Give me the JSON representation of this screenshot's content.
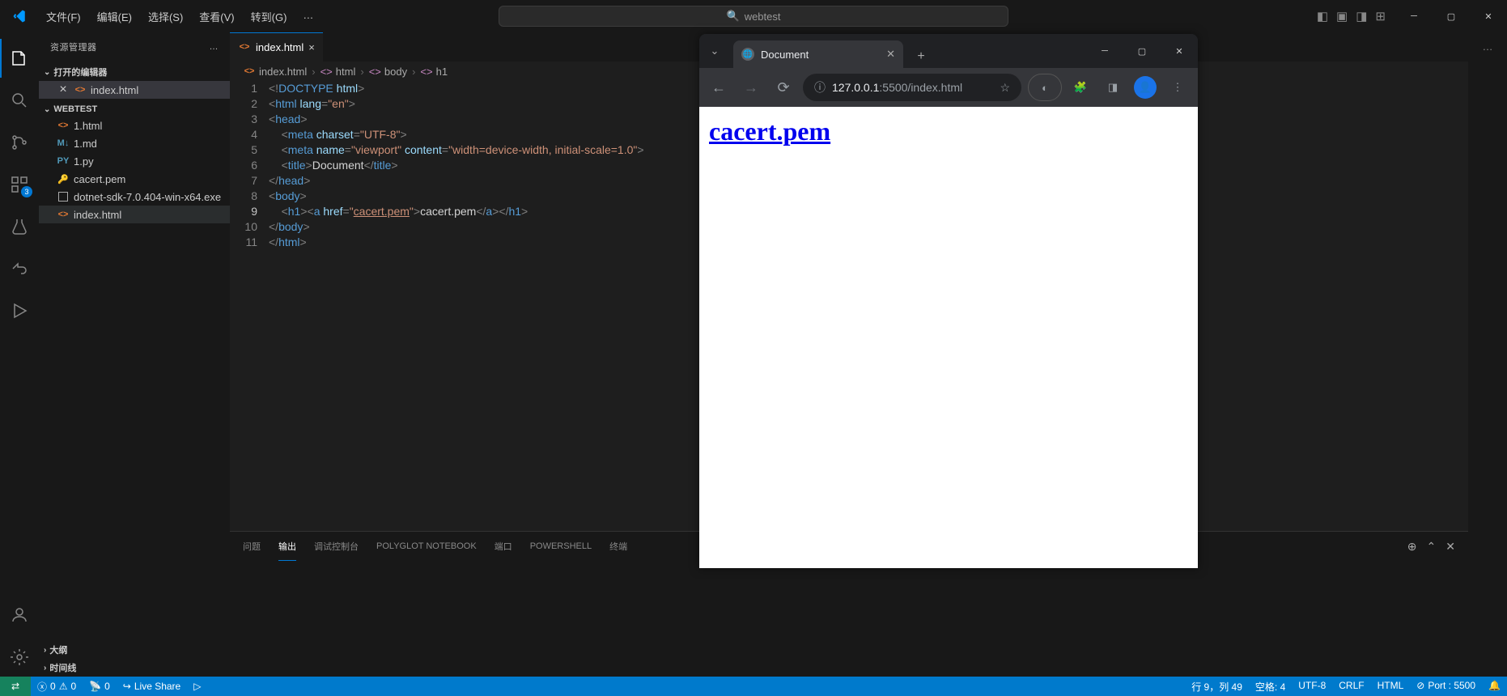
{
  "menu": {
    "file": "文件(F)",
    "edit": "编辑(E)",
    "select": "选择(S)",
    "view": "查看(V)",
    "go": "转到(G)",
    "more": "…"
  },
  "search_placeholder": "webtest",
  "explorer": {
    "title": "资源管理器",
    "open_editors": "打开的编辑器",
    "open_file": "index.html",
    "workspace": "WEBTEST",
    "files": [
      {
        "name": "1.html",
        "ico": "html"
      },
      {
        "name": "1.md",
        "ico": "md"
      },
      {
        "name": "1.py",
        "ico": "py"
      },
      {
        "name": "cacert.pem",
        "ico": "cert"
      },
      {
        "name": "dotnet-sdk-7.0.404-win-x64.exe",
        "ico": "exe"
      },
      {
        "name": "index.html",
        "ico": "html"
      }
    ],
    "outline": "大纲",
    "timeline": "时间线"
  },
  "tab": {
    "name": "index.html"
  },
  "breadcrumb": {
    "file": "index.html",
    "parts": [
      "html",
      "body",
      "h1"
    ]
  },
  "code": {
    "lines": [
      "1",
      "2",
      "3",
      "4",
      "5",
      "6",
      "7",
      "8",
      "9",
      "10",
      "11"
    ],
    "current": 9
  },
  "panel": {
    "problems": "问题",
    "output": "输出",
    "debug": "调试控制台",
    "polyglot": "POLYGLOT NOTEBOOK",
    "ports": "端口",
    "powershell": "POWERSHELL",
    "terminal": "终端"
  },
  "status": {
    "errors": "0",
    "warnings": "0",
    "ports": "0",
    "liveshare": "Live Share",
    "cursor": "行 9，列 49",
    "spaces": "空格: 4",
    "encoding": "UTF-8",
    "eol": "CRLF",
    "lang": "HTML",
    "port": "Port : 5500"
  },
  "browser": {
    "tab_title": "Document",
    "addr_host": "127.0.0.1",
    "addr_path": ":5500/index.html",
    "link_text": "cacert.pem"
  },
  "activity_badge": "3"
}
